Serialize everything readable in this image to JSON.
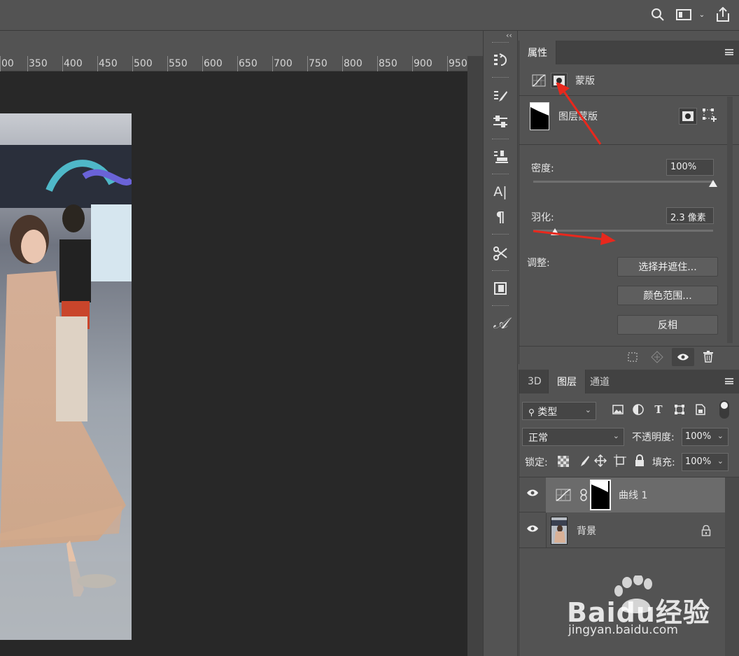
{
  "ruler": {
    "ticks": [
      "00",
      "350",
      "400",
      "450",
      "500",
      "550",
      "600",
      "650",
      "700",
      "750",
      "800",
      "850",
      "900",
      "950"
    ]
  },
  "properties": {
    "tab_label": "属性",
    "mask_type_label": "蒙版",
    "layer_mask_label": "图层蒙版",
    "density_label": "密度:",
    "density_value": "100%",
    "density_percent": 100,
    "feather_label": "羽化:",
    "feather_value": "2.3 像素",
    "feather_fraction": 0.12,
    "adjust_label": "调整:",
    "buttons": [
      "选择并遮住...",
      "颜色范围...",
      "反相"
    ]
  },
  "layers": {
    "tabs": [
      "3D",
      "图层",
      "通道"
    ],
    "active_tab": "图层",
    "filter_label": "类型",
    "blend_mode": "正常",
    "opacity_label": "不透明度:",
    "opacity_value": "100%",
    "lock_label": "锁定:",
    "fill_label": "填充:",
    "fill_value": "100%",
    "rows": [
      {
        "name": "曲线 1"
      },
      {
        "name": "背景"
      }
    ]
  },
  "watermark": {
    "brand": "Baidu经验",
    "url": "jingyan.baidu.com"
  },
  "colors": {
    "panel_bg": "#535353",
    "canvas_bg": "#282828",
    "accent_arrow": "#e8281d"
  }
}
